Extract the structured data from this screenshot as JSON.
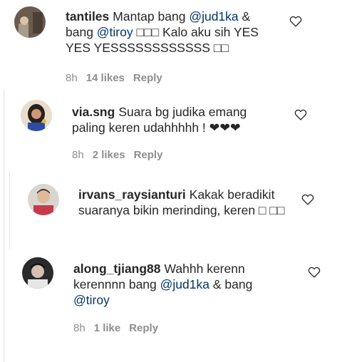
{
  "comments": [
    {
      "username": "tantiles",
      "text_parts": [
        "Mantap bang ",
        "@jud1ka",
        " & bang ",
        "@tiroy",
        " □□□ Kalo aku sih YES YES YESSSSSSSSSSSS □□"
      ],
      "time": "8h",
      "likes": "14 likes",
      "reply": "Reply"
    },
    {
      "username": "via.sng",
      "text": "Suara bg judika emang paling keren udahhhhh ! ❤❤❤",
      "time": "8h",
      "likes": "2 likes",
      "reply": "Reply"
    },
    {
      "username": "irvans_raysianturi",
      "text": "Kakak beradikit suaranya bikin merinding, keren □ □□"
    },
    {
      "username": "along_tjiang88",
      "text_parts": [
        "Wahhh kerenn kerennnn bang ",
        "@jud1ka",
        " & bang ",
        "@tiroy"
      ],
      "time": "8h",
      "likes": "1 like",
      "reply": "Reply"
    }
  ],
  "icons": {
    "like": "heart-outline-icon"
  },
  "colors": {
    "text": "#262626",
    "mention": "#003569",
    "meta": "#8e8e8e"
  }
}
